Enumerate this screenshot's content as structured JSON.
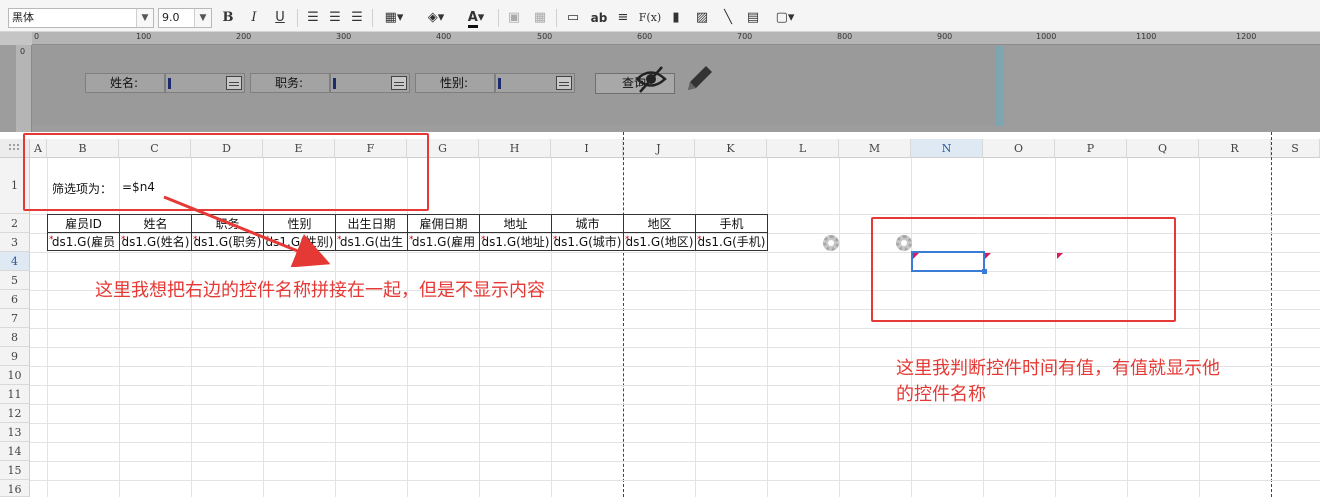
{
  "toolbar": {
    "font_family": "黑体",
    "font_size": "9.0",
    "bold": "B",
    "italic": "I",
    "underline": "U",
    "text_label": "ab",
    "formula_label": "F(x)"
  },
  "ruler": {
    "marks": [
      "0",
      "100",
      "200",
      "300",
      "400",
      "500",
      "600",
      "700",
      "800",
      "900",
      "1000",
      "1100",
      "1200"
    ],
    "vertical_mark": "0"
  },
  "form": {
    "fields": [
      {
        "label": "姓名:"
      },
      {
        "label": "职务:"
      },
      {
        "label": "性别:"
      }
    ],
    "query_button": "查询"
  },
  "sheet": {
    "columns": [
      "A",
      "B",
      "C",
      "D",
      "E",
      "F",
      "G",
      "H",
      "I",
      "J",
      "K",
      "L",
      "M",
      "N",
      "O",
      "P",
      "Q",
      "R",
      "S"
    ],
    "selected_column": "N",
    "rows": [
      "1",
      "2",
      "3",
      "4",
      "5",
      "6",
      "7",
      "8",
      "9",
      "10",
      "11",
      "12",
      "13",
      "14",
      "15",
      "16"
    ],
    "selected_row": "4",
    "filter_label": "筛选项为：",
    "filter_formula": "=$n4",
    "headers": [
      "雇员ID",
      "姓名",
      "职务",
      "性别",
      "出生日期",
      "雇佣日期",
      "地址",
      "城市",
      "地区",
      "手机"
    ],
    "data": [
      "ds1.G(雇员",
      "ds1.G(姓名)",
      "ds1.G(职务)",
      "ds1.G(性别)",
      "ds1.G(出生",
      "ds1.G(雇用",
      "ds1.G(地址)",
      "ds1.G(城市)",
      "ds1.G(地区)",
      "ds1.G(手机)"
    ]
  },
  "annotations": {
    "left_note": "这里我想把右边的控件名称拼接在一起，但是不显示内容",
    "right_note_line1": "这里我判断控件时间有值，有值就显示他",
    "right_note_line2": "的控件名称"
  }
}
